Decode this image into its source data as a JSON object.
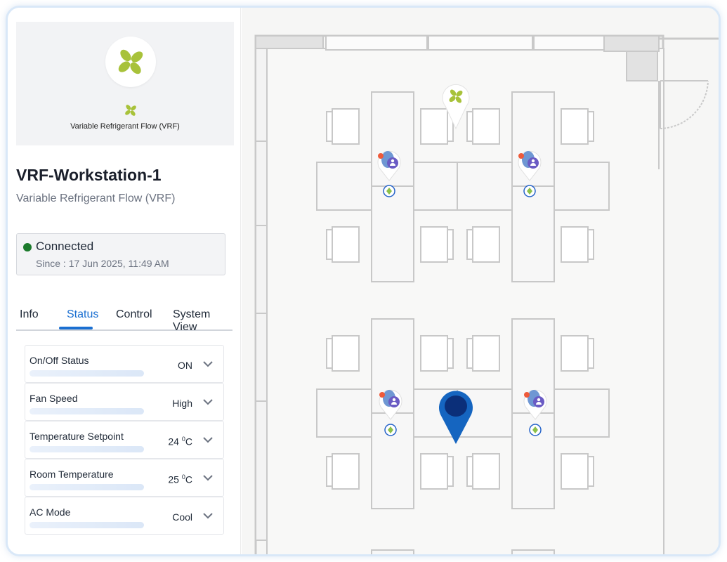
{
  "device": {
    "card_caption": "Variable Refrigerant Flow (VRF)",
    "name": "VRF-Workstation-1",
    "type": "Variable Refrigerant Flow (VRF)",
    "icon": "fan-icon",
    "icon_color": "#a8c23a"
  },
  "connection": {
    "status": "Connected",
    "since": "Since : 17 Jun 2025, 11:49 AM",
    "status_color": "#1b7a2c"
  },
  "tabs": [
    {
      "label": "Info"
    },
    {
      "label": "Status",
      "active": true
    },
    {
      "label": "Control"
    },
    {
      "label": "System View"
    }
  ],
  "status_rows": [
    {
      "label": "On/Off Status",
      "value": "ON"
    },
    {
      "label": "Fan Speed",
      "value": "High"
    },
    {
      "label": "Temperature Setpoint",
      "value": "24 ",
      "unit": "0",
      "unit_suffix": "C"
    },
    {
      "label": "Room Temperature",
      "value": "25 ",
      "unit": "0",
      "unit_suffix": "C"
    },
    {
      "label": "AC Mode",
      "value": "Cool"
    }
  ],
  "map": {
    "markers": [
      "fan-marker",
      "occupancy-marker",
      "location-pin"
    ],
    "accent": "#1a6fd1",
    "pin_color": "#1565c0"
  }
}
